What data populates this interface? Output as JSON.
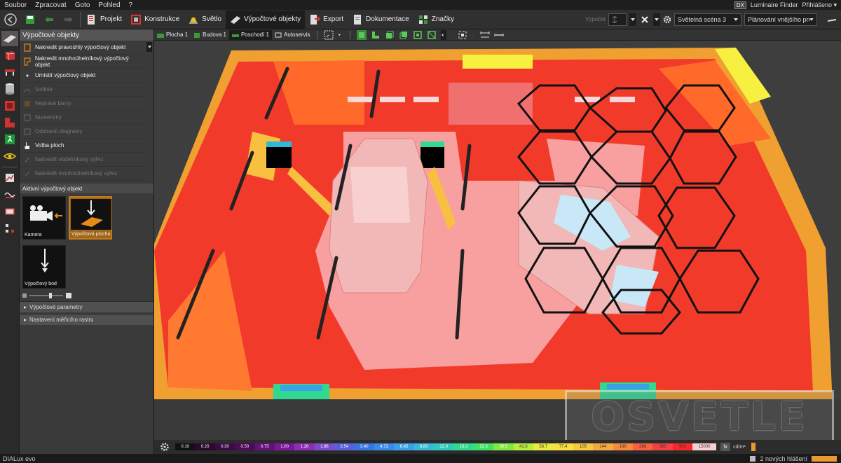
{
  "menu": [
    "Soubor",
    "Zpracovat",
    "Goto",
    "Pohled",
    "?"
  ],
  "menu_right": {
    "dx": "DX",
    "finder": "Luminaire Finder",
    "login": "Přihlášeno ▾"
  },
  "toolbar": {
    "tabs": [
      {
        "label": "Projekt",
        "icon": "project-icon",
        "active": false
      },
      {
        "label": "Konstrukce",
        "icon": "construction-icon",
        "active": false
      },
      {
        "label": "Světlo",
        "icon": "light-icon",
        "active": false
      },
      {
        "label": "Výpočtové objekty",
        "icon": "calc-objects-icon",
        "active": true
      },
      {
        "label": "Export",
        "icon": "export-icon",
        "active": false
      },
      {
        "label": "Dokumentace",
        "icon": "documentation-icon",
        "active": false
      },
      {
        "label": "Značky",
        "icon": "marks-icon",
        "active": false
      }
    ],
    "calc_label": "Výpočet",
    "scene_select": "Světelná scéna 3",
    "planning_select": "Plánování vnějšího prost..."
  },
  "panel": {
    "title": "Výpočtové objekty",
    "commands": [
      {
        "label": "Nakreslit pravoúhlý výpočtový objekt",
        "disabled": false
      },
      {
        "label": "Nakreslit mnohoúhelníkový výpočtový objekt",
        "disabled": false
      },
      {
        "label": "Umístit výpočtový objekt",
        "disabled": false
      },
      {
        "label": "Izolinie",
        "disabled": true
      },
      {
        "label": "Nepravé barvy",
        "disabled": true
      },
      {
        "label": "Numerický",
        "disabled": true
      },
      {
        "label": "Odstranit diagramy",
        "disabled": true
      },
      {
        "label": "Volba ploch",
        "disabled": false
      },
      {
        "label": "Nakreslit obdélníkový výřez",
        "disabled": true
      },
      {
        "label": "Nakreslit mnohoúhelníkový výřez",
        "disabled": true
      }
    ],
    "active_header": "Aktivní výpočtový objekt",
    "tiles": [
      {
        "label": "Kamera",
        "selected": false
      },
      {
        "label": "Výpočtová plocha",
        "selected": true
      },
      {
        "label": "Výpočtový bod",
        "selected": false
      }
    ],
    "accordion": [
      "Výpočtové parametry",
      "Nastavení měřicího rastru"
    ]
  },
  "viewtabs": [
    {
      "label": "Plocha 1",
      "active": false
    },
    {
      "label": "Budova 1",
      "active": false
    },
    {
      "label": "Poschodí 1",
      "active": true
    },
    {
      "label": "Autoservis",
      "active": false
    }
  ],
  "scale": {
    "values": [
      "0.10",
      "0.20",
      "0.30",
      "0.50",
      "0.75",
      "1.00",
      "1.26",
      "1.86",
      "2.54",
      "3.40",
      "4.72",
      "6.45",
      "8.80",
      "12.0",
      "16.3",
      "22.3",
      "30.5",
      "41.6",
      "56.7",
      "77.4",
      "105",
      "144",
      "196",
      "268",
      "365",
      "500",
      "15000"
    ],
    "colors": [
      "#111111",
      "#2a0a2a",
      "#3a0a44",
      "#4c0a5a",
      "#62107a",
      "#7a1899",
      "#8a30b0",
      "#7a4cc8",
      "#5a60d8",
      "#3a74e0",
      "#3a8ae8",
      "#3aa0e8",
      "#3ab8d8",
      "#30c8b8",
      "#30d890",
      "#40e060",
      "#80e840",
      "#b8ec40",
      "#e8ec40",
      "#f8e040",
      "#f8c840",
      "#f8a840",
      "#f88840",
      "#f86040",
      "#f84040",
      "#f82828",
      "#f8d0d0"
    ],
    "unit_btn": "fx",
    "unit": "cd/m²"
  },
  "watermark": "OSVETLE",
  "status": {
    "app": "DIALux evo",
    "messages": "2 nových hlášení"
  }
}
